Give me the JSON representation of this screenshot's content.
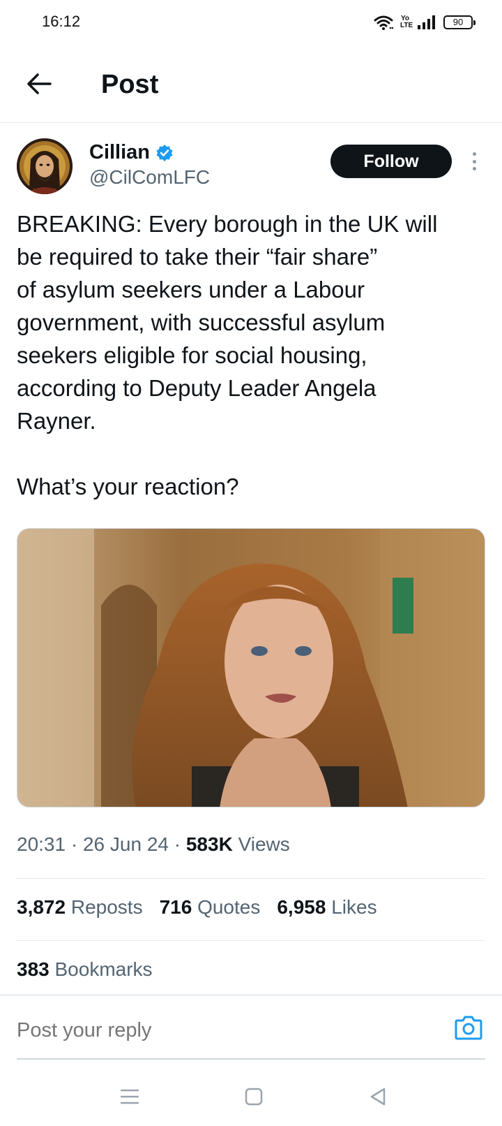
{
  "status_bar": {
    "time": "16:12",
    "volte_top": "Yo",
    "volte_bottom": "LTE",
    "battery": "90"
  },
  "header": {
    "title": "Post",
    "back_icon": "arrow-left-icon"
  },
  "author": {
    "display_name": "Cillian",
    "handle": "@CilComLFC",
    "verified": true,
    "follow_label": "Follow"
  },
  "post": {
    "text": "BREAKING: Every borough in the UK will\nbe required to take their “fair share”\nof asylum seekers under a Labour\ngovernment, with successful asylum\nseekers eligible for social housing,\naccording to Deputy Leader Angela\nRayner.\n\nWhat’s your reaction?"
  },
  "meta": {
    "time": "20:31",
    "sep1": " · ",
    "date": "26 Jun 24",
    "sep2": " · ",
    "views_count": "583K",
    "views_label": " Views"
  },
  "stats": {
    "reposts_count": "3,872",
    "reposts_label": " Reposts",
    "quotes_count": "716",
    "quotes_label": " Quotes",
    "likes_count": "6,958",
    "likes_label": " Likes",
    "bookmarks_count": "383",
    "bookmarks_label": " Bookmarks"
  },
  "reply": {
    "placeholder": "Post your reply"
  },
  "colors": {
    "accent": "#1d9bf0",
    "text_primary": "#0f1419",
    "text_secondary": "#536471"
  }
}
